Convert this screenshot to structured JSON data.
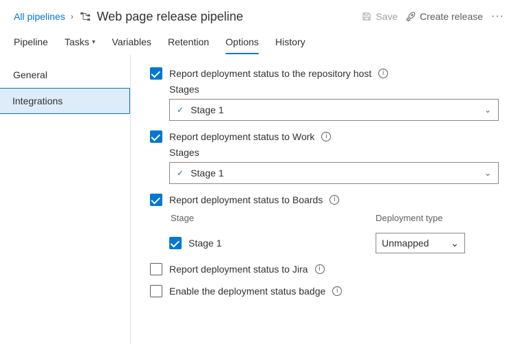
{
  "breadcrumb": {
    "parent": "All pipelines"
  },
  "page_title": "Web page release pipeline",
  "header_actions": {
    "save": "Save",
    "create_release": "Create release"
  },
  "tabs": {
    "pipeline": "Pipeline",
    "tasks": "Tasks",
    "variables": "Variables",
    "retention": "Retention",
    "options": "Options",
    "history": "History"
  },
  "sidebar": {
    "general": "General",
    "integrations": "Integrations"
  },
  "options": {
    "repo_host": {
      "label": "Report deployment status to the repository host",
      "stages_label": "Stages",
      "stage_value": "Stage 1"
    },
    "work": {
      "label": "Report deployment status to Work",
      "stages_label": "Stages",
      "stage_value": "Stage 1"
    },
    "boards": {
      "label": "Report deployment status to Boards",
      "col_stage": "Stage",
      "col_dep": "Deployment type",
      "row_stage": "Stage 1",
      "row_dep": "Unmapped"
    },
    "jira": {
      "label": "Report deployment status to Jira"
    },
    "badge": {
      "label": "Enable the deployment status badge"
    }
  }
}
